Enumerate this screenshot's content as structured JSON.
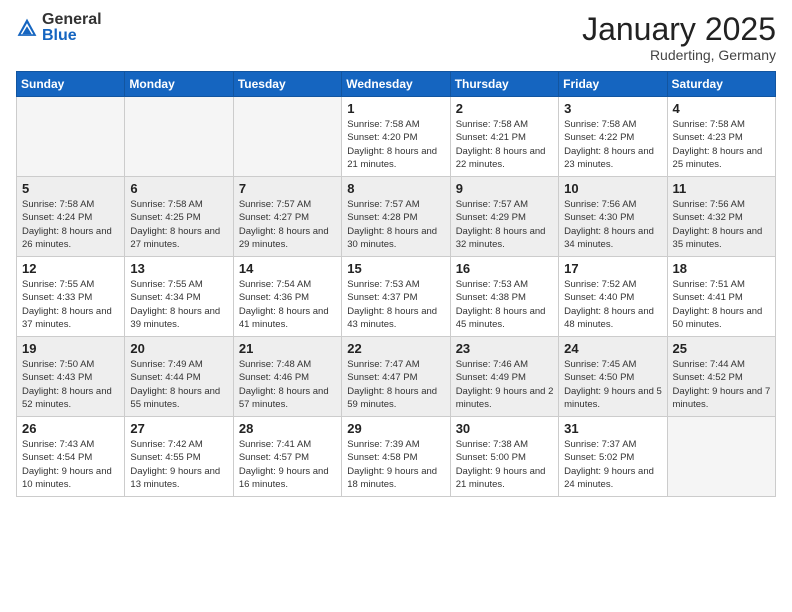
{
  "header": {
    "logo_general": "General",
    "logo_blue": "Blue",
    "month_title": "January 2025",
    "subtitle": "Ruderting, Germany"
  },
  "columns": [
    "Sunday",
    "Monday",
    "Tuesday",
    "Wednesday",
    "Thursday",
    "Friday",
    "Saturday"
  ],
  "weeks": [
    [
      {
        "day": "",
        "info": ""
      },
      {
        "day": "",
        "info": ""
      },
      {
        "day": "",
        "info": ""
      },
      {
        "day": "1",
        "info": "Sunrise: 7:58 AM\nSunset: 4:20 PM\nDaylight: 8 hours\nand 21 minutes."
      },
      {
        "day": "2",
        "info": "Sunrise: 7:58 AM\nSunset: 4:21 PM\nDaylight: 8 hours\nand 22 minutes."
      },
      {
        "day": "3",
        "info": "Sunrise: 7:58 AM\nSunset: 4:22 PM\nDaylight: 8 hours\nand 23 minutes."
      },
      {
        "day": "4",
        "info": "Sunrise: 7:58 AM\nSunset: 4:23 PM\nDaylight: 8 hours\nand 25 minutes."
      }
    ],
    [
      {
        "day": "5",
        "info": "Sunrise: 7:58 AM\nSunset: 4:24 PM\nDaylight: 8 hours\nand 26 minutes."
      },
      {
        "day": "6",
        "info": "Sunrise: 7:58 AM\nSunset: 4:25 PM\nDaylight: 8 hours\nand 27 minutes."
      },
      {
        "day": "7",
        "info": "Sunrise: 7:57 AM\nSunset: 4:27 PM\nDaylight: 8 hours\nand 29 minutes."
      },
      {
        "day": "8",
        "info": "Sunrise: 7:57 AM\nSunset: 4:28 PM\nDaylight: 8 hours\nand 30 minutes."
      },
      {
        "day": "9",
        "info": "Sunrise: 7:57 AM\nSunset: 4:29 PM\nDaylight: 8 hours\nand 32 minutes."
      },
      {
        "day": "10",
        "info": "Sunrise: 7:56 AM\nSunset: 4:30 PM\nDaylight: 8 hours\nand 34 minutes."
      },
      {
        "day": "11",
        "info": "Sunrise: 7:56 AM\nSunset: 4:32 PM\nDaylight: 8 hours\nand 35 minutes."
      }
    ],
    [
      {
        "day": "12",
        "info": "Sunrise: 7:55 AM\nSunset: 4:33 PM\nDaylight: 8 hours\nand 37 minutes."
      },
      {
        "day": "13",
        "info": "Sunrise: 7:55 AM\nSunset: 4:34 PM\nDaylight: 8 hours\nand 39 minutes."
      },
      {
        "day": "14",
        "info": "Sunrise: 7:54 AM\nSunset: 4:36 PM\nDaylight: 8 hours\nand 41 minutes."
      },
      {
        "day": "15",
        "info": "Sunrise: 7:53 AM\nSunset: 4:37 PM\nDaylight: 8 hours\nand 43 minutes."
      },
      {
        "day": "16",
        "info": "Sunrise: 7:53 AM\nSunset: 4:38 PM\nDaylight: 8 hours\nand 45 minutes."
      },
      {
        "day": "17",
        "info": "Sunrise: 7:52 AM\nSunset: 4:40 PM\nDaylight: 8 hours\nand 48 minutes."
      },
      {
        "day": "18",
        "info": "Sunrise: 7:51 AM\nSunset: 4:41 PM\nDaylight: 8 hours\nand 50 minutes."
      }
    ],
    [
      {
        "day": "19",
        "info": "Sunrise: 7:50 AM\nSunset: 4:43 PM\nDaylight: 8 hours\nand 52 minutes."
      },
      {
        "day": "20",
        "info": "Sunrise: 7:49 AM\nSunset: 4:44 PM\nDaylight: 8 hours\nand 55 minutes."
      },
      {
        "day": "21",
        "info": "Sunrise: 7:48 AM\nSunset: 4:46 PM\nDaylight: 8 hours\nand 57 minutes."
      },
      {
        "day": "22",
        "info": "Sunrise: 7:47 AM\nSunset: 4:47 PM\nDaylight: 8 hours\nand 59 minutes."
      },
      {
        "day": "23",
        "info": "Sunrise: 7:46 AM\nSunset: 4:49 PM\nDaylight: 9 hours\nand 2 minutes."
      },
      {
        "day": "24",
        "info": "Sunrise: 7:45 AM\nSunset: 4:50 PM\nDaylight: 9 hours\nand 5 minutes."
      },
      {
        "day": "25",
        "info": "Sunrise: 7:44 AM\nSunset: 4:52 PM\nDaylight: 9 hours\nand 7 minutes."
      }
    ],
    [
      {
        "day": "26",
        "info": "Sunrise: 7:43 AM\nSunset: 4:54 PM\nDaylight: 9 hours\nand 10 minutes."
      },
      {
        "day": "27",
        "info": "Sunrise: 7:42 AM\nSunset: 4:55 PM\nDaylight: 9 hours\nand 13 minutes."
      },
      {
        "day": "28",
        "info": "Sunrise: 7:41 AM\nSunset: 4:57 PM\nDaylight: 9 hours\nand 16 minutes."
      },
      {
        "day": "29",
        "info": "Sunrise: 7:39 AM\nSunset: 4:58 PM\nDaylight: 9 hours\nand 18 minutes."
      },
      {
        "day": "30",
        "info": "Sunrise: 7:38 AM\nSunset: 5:00 PM\nDaylight: 9 hours\nand 21 minutes."
      },
      {
        "day": "31",
        "info": "Sunrise: 7:37 AM\nSunset: 5:02 PM\nDaylight: 9 hours\nand 24 minutes."
      },
      {
        "day": "",
        "info": ""
      }
    ]
  ],
  "shaded_rows": [
    1,
    3
  ]
}
